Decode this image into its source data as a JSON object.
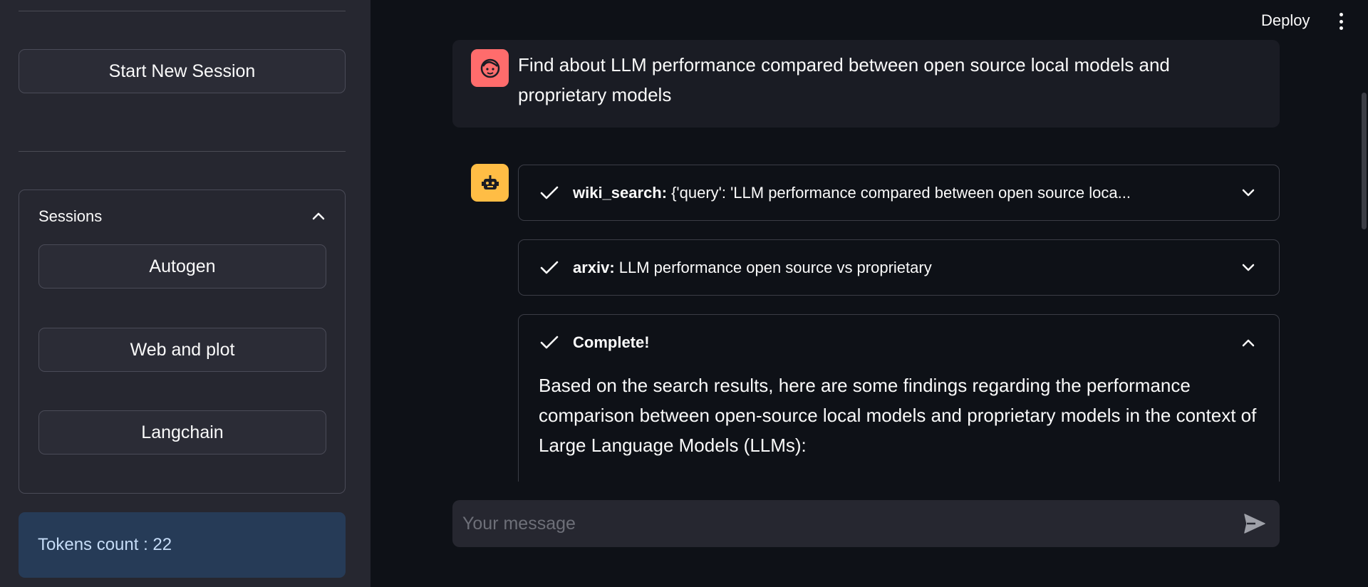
{
  "sidebar": {
    "new_session_label": "Start New Session",
    "sessions_title": "Sessions",
    "sessions": [
      {
        "label": "Autogen"
      },
      {
        "label": "Web and plot"
      },
      {
        "label": "Langchain"
      }
    ],
    "tokens_label": "Tokens count : 22"
  },
  "header": {
    "deploy_label": "Deploy"
  },
  "chat": {
    "user_message": "Find about LLM performance compared between open source local models and proprietary models",
    "tool_steps": [
      {
        "tool": "wiki_search:",
        "detail": "{'query': 'LLM performance compared between open source loca...",
        "state": "collapsed"
      },
      {
        "tool": "arxiv:",
        "detail": "LLM performance open source vs proprietary",
        "state": "collapsed"
      }
    ],
    "complete_label": "Complete!",
    "answer": "Based on the search results, here are some findings regarding the performance comparison between open-source local models and proprietary models in the context of Large Language Models (LLMs):",
    "input_placeholder": "Your message"
  },
  "colors": {
    "user_avatar": "#ff6c6c",
    "bot_avatar": "#ffbd45",
    "tokens_bg": "#263b57"
  },
  "icons": {
    "user_avatar": "face-icon",
    "bot_avatar": "robot-icon",
    "step_status": "check-icon",
    "send": "send-icon",
    "menu": "kebab-menu-icon"
  }
}
